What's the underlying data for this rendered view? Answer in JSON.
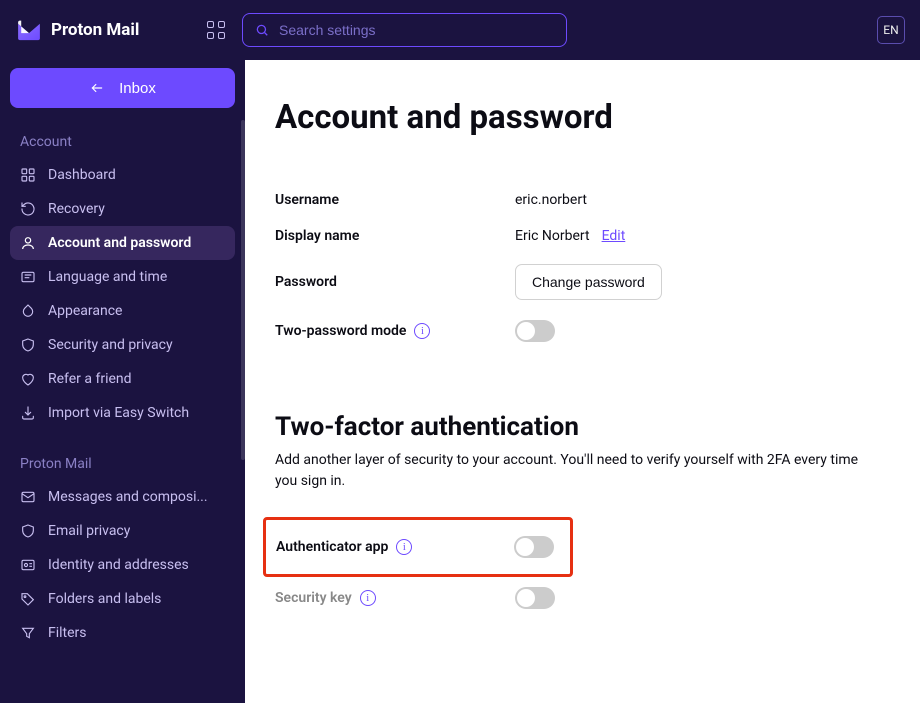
{
  "header": {
    "app_name": "Proton Mail",
    "search_placeholder": "Search settings",
    "lang": "EN"
  },
  "sidebar": {
    "inbox_label": "Inbox",
    "sections": [
      {
        "heading": "Account",
        "items": [
          {
            "label": "Dashboard",
            "icon": "dashboard"
          },
          {
            "label": "Recovery",
            "icon": "recovery"
          },
          {
            "label": "Account and password",
            "icon": "user",
            "active": true
          },
          {
            "label": "Language and time",
            "icon": "language"
          },
          {
            "label": "Appearance",
            "icon": "appearance"
          },
          {
            "label": "Security and privacy",
            "icon": "shield"
          },
          {
            "label": "Refer a friend",
            "icon": "heart"
          },
          {
            "label": "Import via Easy Switch",
            "icon": "import"
          }
        ]
      },
      {
        "heading": "Proton Mail",
        "items": [
          {
            "label": "Messages and composi...",
            "icon": "messages"
          },
          {
            "label": "Email privacy",
            "icon": "shield"
          },
          {
            "label": "Identity and addresses",
            "icon": "identity"
          },
          {
            "label": "Folders and labels",
            "icon": "tag"
          },
          {
            "label": "Filters",
            "icon": "filter"
          }
        ]
      }
    ]
  },
  "page": {
    "title": "Account and password",
    "fields": {
      "username_label": "Username",
      "username_value": "eric.norbert",
      "display_name_label": "Display name",
      "display_name_value": "Eric Norbert",
      "edit_label": "Edit",
      "password_label": "Password",
      "change_password_label": "Change password",
      "two_password_label": "Two-password mode"
    },
    "tfa": {
      "title": "Two-factor authentication",
      "desc": "Add another layer of security to your account. You'll need to verify yourself with 2FA every time you sign in.",
      "auth_app_label": "Authenticator app",
      "security_key_label": "Security key"
    }
  }
}
